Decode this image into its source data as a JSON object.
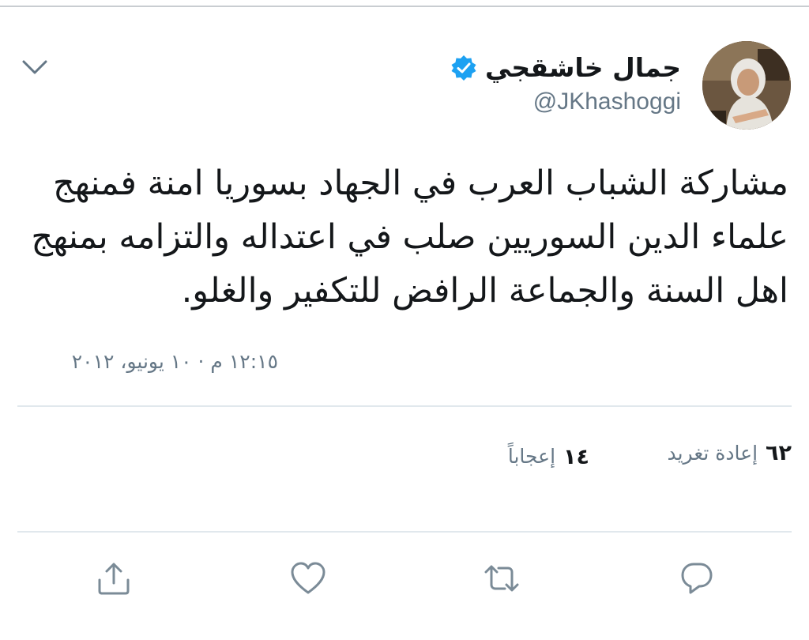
{
  "tweet": {
    "author_name": "جمال خاشقجي",
    "handle": "@JKhashoggi",
    "verified": true,
    "text_lines": [
      "مشاركة الشباب العرب في الجهاد بسوريا امنة فمنهج",
      "علماء الدين السوريين صلب في اعتداله والتزامه بمنهج",
      "اهل السنة والجماعة الرافض للتكفير والغلو."
    ],
    "timestamp": "١٢:١٥ م · ١٠ يونيو، ٢٠١٢"
  },
  "stats": {
    "retweets_count": "٦٢",
    "retweets_label": "إعادة تغريد",
    "likes_count": "١٤",
    "likes_label": "إعجاباً"
  },
  "actions": {
    "reply_icon": "reply-icon",
    "retweet_icon": "retweet-icon",
    "like_icon": "heart-icon",
    "share_icon": "share-icon"
  },
  "colors": {
    "text": "#14171a",
    "secondary": "#657786",
    "verified": "#1da1f2",
    "divider": "#e1e8ed"
  }
}
